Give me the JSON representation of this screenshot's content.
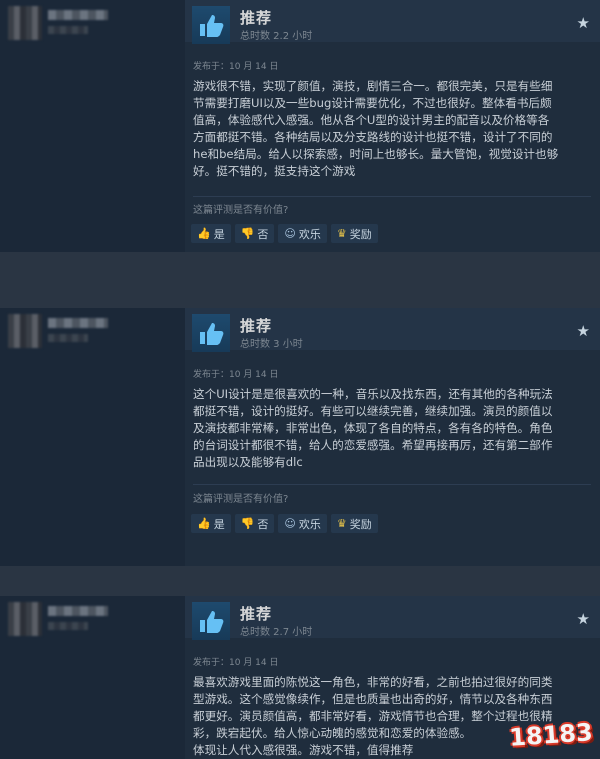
{
  "reviews": [
    {
      "recommendation": "推荐",
      "hours": "总时数 2.2 小时",
      "posted": "发布于：10 月 14 日",
      "text": "游戏很不错，实现了颜值，演技，剧情三合一。都很完美，只是有些细\n节需要打磨UI以及一些bug设计需要优化，不过也很好。整体看书后颇\n值高，体验感代入感强。他从各个U型的设计男主的配音以及价格等各\n方面都挺不错。各种结局以及分支路线的设计也挺不错，设计了不同的\nhe和be结局。给人以探索感，时间上也够长。量大管饱，视觉设计也够\n好。挺不错的，挺支持这个游戏",
      "helpful_question": "这篇评测是否有价值?",
      "buttons": {
        "yes": "是",
        "no": "否",
        "funny": "欢乐",
        "award": "奖励"
      }
    },
    {
      "recommendation": "推荐",
      "hours": "总时数 3 小时",
      "posted": "发布于：10 月 14 日",
      "text": "这个UI设计是是很喜欢的一种，音乐以及找东西，还有其他的各种玩法\n都挺不错，设计的挺好。有些可以继续完善，继续加强。演员的颜值以\n及演技都非常棒，非常出色，体现了各自的特点，各有各的特色。角色\n的台词设计都很不错，给人的恋爱感强。希望再接再厉，还有第二部作\n品出现以及能够有dlc",
      "helpful_question": "这篇评测是否有价值?",
      "buttons": {
        "yes": "是",
        "no": "否",
        "funny": "欢乐",
        "award": "奖励"
      }
    },
    {
      "recommendation": "推荐",
      "hours": "总时数 2.7 小时",
      "posted": "发布于：10 月 14 日",
      "text": "最喜欢游戏里面的陈悦这一角色，非常的好看，之前也拍过很好的同类\n型游戏。这个感觉像续作，但是也质量也出奇的好，情节以及各种东西\n都更好。演员颜值高，都非常好看，游戏情节也合理，整个过程也很精\n彩，跌宕起伏。给人惊心动魄的感觉和恋爱的体验感。\n体现让人代入感很强。游戏不错，值得推荐"
    }
  ],
  "watermark": "18183",
  "colors": {
    "background": "#1b2838",
    "accent": "#66c0f4"
  }
}
